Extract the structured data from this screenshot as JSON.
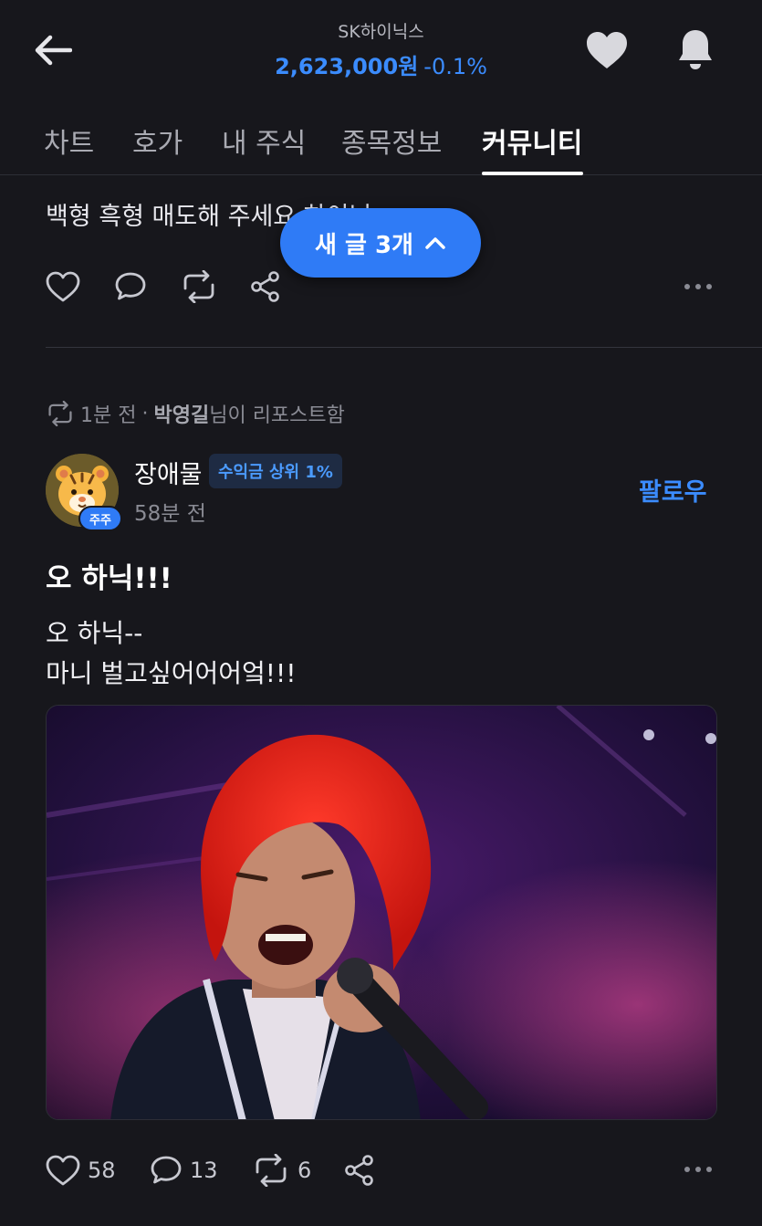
{
  "header": {
    "stock_name": "SK하이닉스",
    "price": "2,623,000원",
    "change": "-0.1%",
    "price_color": "#3b8cff"
  },
  "tabs": [
    {
      "label": "차트",
      "active": false
    },
    {
      "label": "호가",
      "active": false
    },
    {
      "label": "내 주식",
      "active": false
    },
    {
      "label": "종목정보",
      "active": false
    },
    {
      "label": "커뮤니티",
      "active": true
    }
  ],
  "prev_post": {
    "text": "백형 흑형 매도해 주세요 하이닉"
  },
  "new_posts_pill": {
    "label": "새 글 3개",
    "color": "#2f7bf6"
  },
  "post": {
    "repost": {
      "time": "1분 전",
      "separator": "·",
      "reposter": "박영길",
      "suffix": "님이 리포스트함"
    },
    "author": "장애물",
    "rank_badge": "수익금 상위 1%",
    "avatar_badge": "주주",
    "time": "58분 전",
    "follow_label": "팔로우",
    "title": "오 하닉!!!",
    "body_lines": [
      "오 하닉--",
      "마니 벌고싶어어어엌!!!"
    ],
    "image_alt": "concert-singer-photo",
    "stats": {
      "likes": "58",
      "comments": "13",
      "reposts": "6"
    }
  },
  "icons": {
    "back": "back-arrow-icon",
    "favorite": "heart-icon",
    "alerts": "bell-icon",
    "like": "heart-outline-icon",
    "comment": "comment-icon",
    "repost": "repost-icon",
    "share": "share-icon",
    "more": "more-dots-icon"
  },
  "accent": "#3b8cff"
}
